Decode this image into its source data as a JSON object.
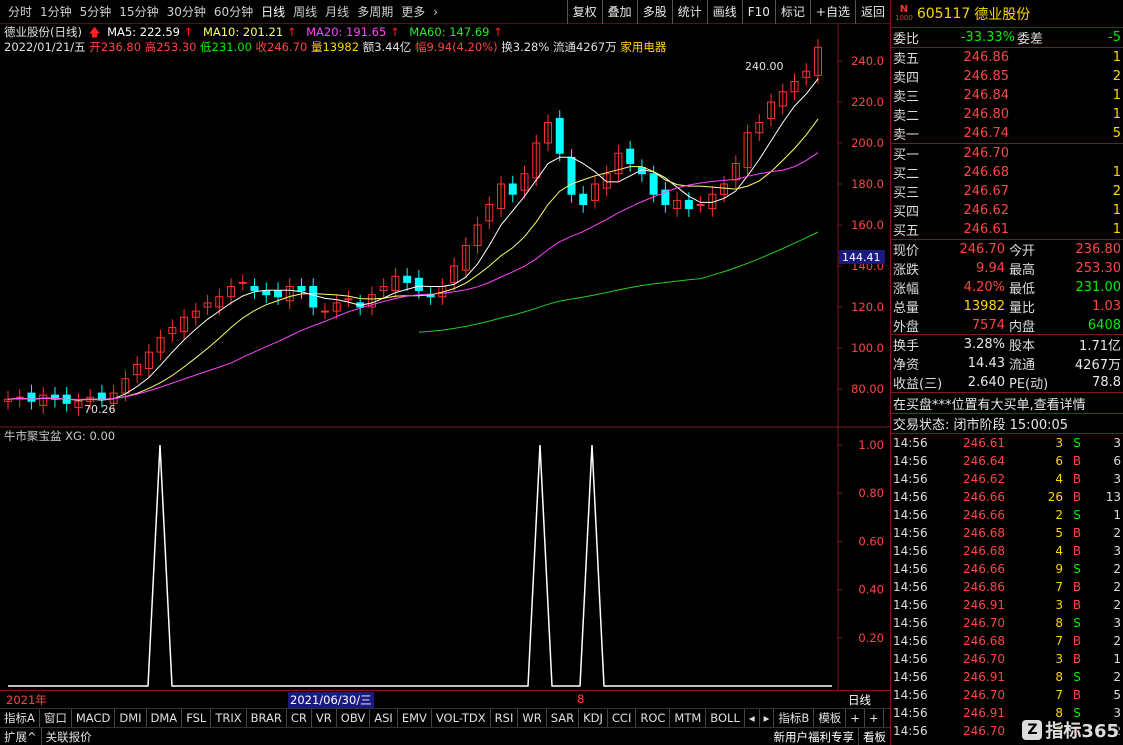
{
  "toolbar": {
    "periods": [
      "分时",
      "1分钟",
      "5分钟",
      "15分钟",
      "30分钟",
      "60分钟",
      "日线",
      "周线",
      "月线",
      "多周期",
      "更多"
    ],
    "active_period": "日线",
    "functions": [
      "复权",
      "叠加",
      "多股",
      "统计",
      "画线",
      "F10",
      "标记",
      "+自选",
      "返回"
    ]
  },
  "info": {
    "name": "德业股份(日线)",
    "ma5": "MA5: 222.59",
    "ma10": "MA10: 201.21",
    "ma20": "MA20: 191.65",
    "ma60": "MA60: 147.69",
    "date": "2022/01/21/五",
    "open": "开236.80",
    "high": "高253.30",
    "low": "低231.00",
    "close": "收246.70",
    "volume": "量13982",
    "amount": "额3.44亿",
    "range": "幅9.94(4.20%)",
    "turnover": "换3.28%",
    "float": "流通4267万",
    "sector": "家用电器"
  },
  "chart": {
    "price_labels": [
      "240.0",
      "220.0",
      "200.0",
      "180.0",
      "160.0",
      "140.0",
      "120.0",
      "100.0",
      "80.00"
    ],
    "current_price_tag": "144.41",
    "max_annot": "240.00",
    "min_annot": "70.26",
    "colors": {
      "up": "#ff3030",
      "down": "#00ffff",
      "ma5": "#ffffff",
      "ma10": "#ffff66",
      "ma20": "#ff44ff",
      "ma60": "#22cc22",
      "grid": "#7a1a1a"
    }
  },
  "sub": {
    "title": "牛市聚宝盆 XG: 0.00",
    "labels": [
      "1.00",
      "0.80",
      "0.60",
      "0.40",
      "0.20"
    ]
  },
  "timeaxis": {
    "start": "2021年",
    "mid": "2021/06/30/三",
    "mark": "8",
    "period": "日线"
  },
  "tabs": [
    "指标A",
    "窗口",
    "MACD",
    "DMI",
    "DMA",
    "FSL",
    "TRIX",
    "BRAR",
    "CR",
    "VR",
    "OBV",
    "ASI",
    "EMV",
    "VOL-TDX",
    "RSI",
    "WR",
    "SAR",
    "KDJ",
    "CCI",
    "ROC",
    "MTM",
    "BOLL",
    "◂",
    "▸",
    "指标B",
    "模板",
    "+",
    "+"
  ],
  "status": {
    "expand": "扩展^",
    "related": "关联报价",
    "ad": "新用户福利专享",
    "side": "看板"
  },
  "stock": {
    "code": "605117",
    "name": "德业股份",
    "n_badge": "N",
    "n_num": "1000"
  },
  "order": {
    "wb_label": "委比",
    "wb_val": "-33.33%",
    "wc_label": "委差",
    "wc_val": "-5",
    "asks": [
      {
        "label": "卖五",
        "price": "246.86",
        "vol": "1"
      },
      {
        "label": "卖四",
        "price": "246.85",
        "vol": "2"
      },
      {
        "label": "卖三",
        "price": "246.84",
        "vol": "1"
      },
      {
        "label": "卖二",
        "price": "246.80",
        "vol": "1"
      },
      {
        "label": "卖一",
        "price": "246.74",
        "vol": "5"
      }
    ],
    "bids": [
      {
        "label": "买一",
        "price": "246.70",
        "vol": ""
      },
      {
        "label": "买二",
        "price": "246.68",
        "vol": "1"
      },
      {
        "label": "买三",
        "price": "246.67",
        "vol": "2"
      },
      {
        "label": "买四",
        "price": "246.62",
        "vol": "1"
      },
      {
        "label": "买五",
        "price": "246.61",
        "vol": "1"
      }
    ]
  },
  "quote": [
    {
      "l1": "现价",
      "v1": "246.70",
      "c1": "red",
      "l2": "今开",
      "v2": "236.80",
      "c2": "red"
    },
    {
      "l1": "涨跌",
      "v1": "9.94",
      "c1": "red",
      "l2": "最高",
      "v2": "253.30",
      "c2": "red"
    },
    {
      "l1": "涨幅",
      "v1": "4.20%",
      "c1": "red",
      "l2": "最低",
      "v2": "231.00",
      "c2": "green"
    },
    {
      "l1": "总量",
      "v1": "13982",
      "c1": "yellow",
      "l2": "量比",
      "v2": "1.03",
      "c2": "red"
    },
    {
      "l1": "外盘",
      "v1": "7574",
      "c1": "red",
      "l2": "内盘",
      "v2": "6408",
      "c2": "green"
    },
    {
      "l1": "换手",
      "v1": "3.28%",
      "c1": "white",
      "l2": "股本",
      "v2": "1.71亿",
      "c2": "white"
    },
    {
      "l1": "净资",
      "v1": "14.43",
      "c1": "white",
      "l2": "流通",
      "v2": "4267万",
      "c2": "white"
    },
    {
      "l1": "收益(三)",
      "v1": "2.640",
      "c1": "white",
      "l2": "PE(动)",
      "v2": "78.8",
      "c2": "white"
    }
  ],
  "notice": "在买盘***位置有大买单,查看详情",
  "trade_status": "交易状态: 闭市阶段 15:00:05",
  "ticks": [
    {
      "t": "14:56",
      "p": "246.61",
      "v": "3",
      "s": "S",
      "n": "3"
    },
    {
      "t": "14:56",
      "p": "246.64",
      "v": "6",
      "s": "B",
      "n": "6"
    },
    {
      "t": "14:56",
      "p": "246.62",
      "v": "4",
      "s": "B",
      "n": "3"
    },
    {
      "t": "14:56",
      "p": "246.66",
      "v": "26",
      "s": "B",
      "n": "13"
    },
    {
      "t": "14:56",
      "p": "246.66",
      "v": "2",
      "s": "S",
      "n": "1"
    },
    {
      "t": "14:56",
      "p": "246.68",
      "v": "5",
      "s": "B",
      "n": "2"
    },
    {
      "t": "14:56",
      "p": "246.68",
      "v": "4",
      "s": "B",
      "n": "3"
    },
    {
      "t": "14:56",
      "p": "246.66",
      "v": "9",
      "s": "S",
      "n": "2"
    },
    {
      "t": "14:56",
      "p": "246.86",
      "v": "7",
      "s": "B",
      "n": "2"
    },
    {
      "t": "14:56",
      "p": "246.91",
      "v": "3",
      "s": "B",
      "n": "2"
    },
    {
      "t": "14:56",
      "p": "246.70",
      "v": "8",
      "s": "S",
      "n": "3"
    },
    {
      "t": "14:56",
      "p": "246.68",
      "v": "7",
      "s": "B",
      "n": "2"
    },
    {
      "t": "14:56",
      "p": "246.70",
      "v": "3",
      "s": "B",
      "n": "1"
    },
    {
      "t": "14:56",
      "p": "246.91",
      "v": "8",
      "s": "S",
      "n": "2"
    },
    {
      "t": "14:56",
      "p": "246.70",
      "v": "7",
      "s": "B",
      "n": "5"
    },
    {
      "t": "14:56",
      "p": "246.91",
      "v": "8",
      "s": "S",
      "n": "3"
    },
    {
      "t": "14:56",
      "p": "246.70",
      "v": "7",
      "s": "B",
      "n": "2"
    }
  ],
  "watermark": "指标365"
}
